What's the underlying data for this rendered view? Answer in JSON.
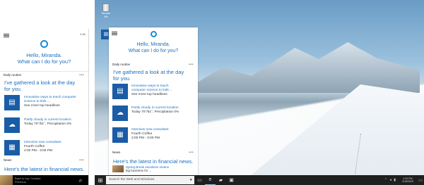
{
  "phone": {
    "status_time": "1:31",
    "greeting_line1": "Hello, Miranda.",
    "greeting_line2": "What can I do for you?",
    "daily_routine": "Daily routine",
    "more": "•••",
    "headline_line1": "I've gathered a look at the day",
    "headline_line2": "for you.",
    "cards": [
      {
        "icon": "news-icon",
        "link1": "Innovative ways to teach computer",
        "link2": "science to kids ...",
        "sub": "See more top headlines"
      },
      {
        "icon": "weather-icon",
        "link1": "Partly cloudy in current location",
        "sub": "Today 70°/51°, Precipitation 0%"
      },
      {
        "icon": "calendar-icon",
        "link1": "Interview new consultant",
        "sub": "Fourth Coffee",
        "sub2": "2:00 PM - 3:00 PM"
      }
    ],
    "news_label": "News",
    "news_headline": "Here's the latest in financial news.",
    "bottom_text": "Back to top: Cortana",
    "bottom_text2": "Previous"
  },
  "desktop": {
    "recycle_bin": "Recycle Bin",
    "cortana": {
      "greeting_line1": "Hello, Miranda.",
      "greeting_line2": "What can I do for you?",
      "daily_routine": "Daily routine",
      "more": "•••",
      "headline_line1": "I've gathered a look at the day",
      "headline_line2": "for you.",
      "cards": [
        {
          "link1": "Innovative ways to teach",
          "link2": "computer science to kids ...",
          "sub": "See more top headlines"
        },
        {
          "link1": "Partly cloudy in current location",
          "sub": "Today 70°/51°, Precipitation 0%"
        },
        {
          "link1": "Interview new consultant",
          "sub": "Fourth Coffee",
          "sub2": "2:00 PM - 3:00 PM"
        }
      ],
      "news_label": "News",
      "news_headline": "Here's the latest in financial news.",
      "news_item": "Spring Break vacations means",
      "news_item2": "big business for ..."
    },
    "taskbar": {
      "search_placeholder": "Search the Web and Windows",
      "clock_time": "1:31 PM",
      "clock_date": "2/16/2015"
    }
  }
}
